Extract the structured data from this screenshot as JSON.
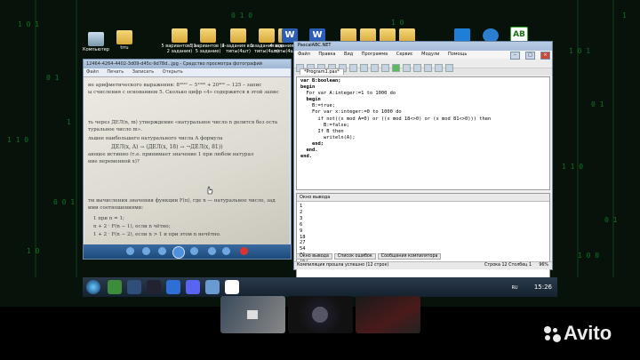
{
  "desktop_icons": [
    {
      "label": "Компьютер",
      "icon": "computer-icon"
    },
    {
      "label": "trru",
      "icon": "folder-icon"
    },
    {
      "label": "5 вариантов (1-2 задания)",
      "icon": "folder-icon"
    },
    {
      "label": "5 вариантов (4-5 задание)",
      "icon": "folder-icon"
    },
    {
      "label": "2 задания все типы(4шт)",
      "icon": "folder-icon"
    },
    {
      "label": "1 задания все типы(4шт)",
      "icon": "folder-icon"
    },
    {
      "label": "4 задания все типы(4шт)",
      "icon": "folder-icon"
    },
    {
      "label": "W",
      "icon": "word-doc-icon"
    },
    {
      "label": "W",
      "icon": "word-doc-icon"
    },
    {
      "label": "",
      "icon": "folder-icon"
    },
    {
      "label": "",
      "icon": "folder-icon"
    },
    {
      "label": "",
      "icon": "folder-icon"
    },
    {
      "label": "",
      "icon": "folder-icon"
    },
    {
      "label": "",
      "icon": "vscode-icon"
    },
    {
      "label": "",
      "icon": "app-icon"
    },
    {
      "label": "AB",
      "icon": "abbyy-icon"
    }
  ],
  "photo_viewer": {
    "title": "12464-4264-4402-3d09-d45c-9d78d...jpg - Средство просмотра фотографий",
    "menu": [
      "Файл",
      "Печать",
      "Записать",
      "Открыть"
    ],
    "photo_lines": [
      "ие арифметического выражения: 8²⁰²⁰ − 5¹⁰⁰⁰ + 20⁴⁰⁰ − 125 – запис",
      "ы счисления с основанием 5. Сколько цифр «4» содержится в этой запис",
      "",
      "ть через ДЕЛ(n, m) утверждение «натуральное число n делится без оста",
      "туральное число m».",
      "льшее наибольшего натурального числа А формула",
      "ДЕЛ(x, A) → (ДЕЛ(x, 18) → ¬ДЕЛ(x, 81))",
      "ающее истинно (т.е. принимает значение 1 при любом натурал",
      "ние переменной x)?",
      "",
      "тм вычисления значения функции F(n), где n — натуральное число, зад",
      "ими соотношениями:",
      "1 при n = 1;",
      "n + 2 · F(n − 1), если n чётно;",
      "1 + 2 · F(n − 2), если n > 1 и при этом n нечётно."
    ]
  },
  "ide": {
    "title": "PascalABC.NET",
    "menu": [
      "Файл",
      "Правка",
      "Вид",
      "Программа",
      "Сервис",
      "Модули",
      "Помощь"
    ],
    "file_tab": "*Program1.pas*",
    "code_lines": [
      "var B:boolean;",
      "begin",
      "  For var A:integer:=1 to 1000 do",
      "  begin",
      "    B:=true;",
      "    For var x:integer:=0 to 1000 do",
      "      if not((x mod A=0) or ((x mod 18<>0) or (x mod 81<>0))) then",
      "        B:=false;",
      "      If B then",
      "        writeln(A);",
      "    end;",
      "  end.",
      "end."
    ],
    "output_header": "Окно вывода",
    "output_lines": [
      "1",
      "2",
      "3",
      "6",
      "9",
      "18",
      "27",
      "54",
      "81",
      "162"
    ],
    "bottom_tabs": [
      "Окно вывода",
      "Список ошибок",
      "Сообщения компилятора"
    ],
    "status_left": "Компиляция прошла успешно (12 строк)",
    "status_pos": "Строка  12  Столбец  1",
    "status_zoom": "96%"
  },
  "taskbar": {
    "lang": "RU",
    "time": "15:26"
  },
  "thumbnails": [
    "thumbnail-1",
    "thumbnail-2",
    "thumbnail-3"
  ],
  "watermark": "Avito",
  "colors": {
    "keyword": "#000000",
    "type": "#1a22c8",
    "taskbar": "#1e2b3a"
  }
}
